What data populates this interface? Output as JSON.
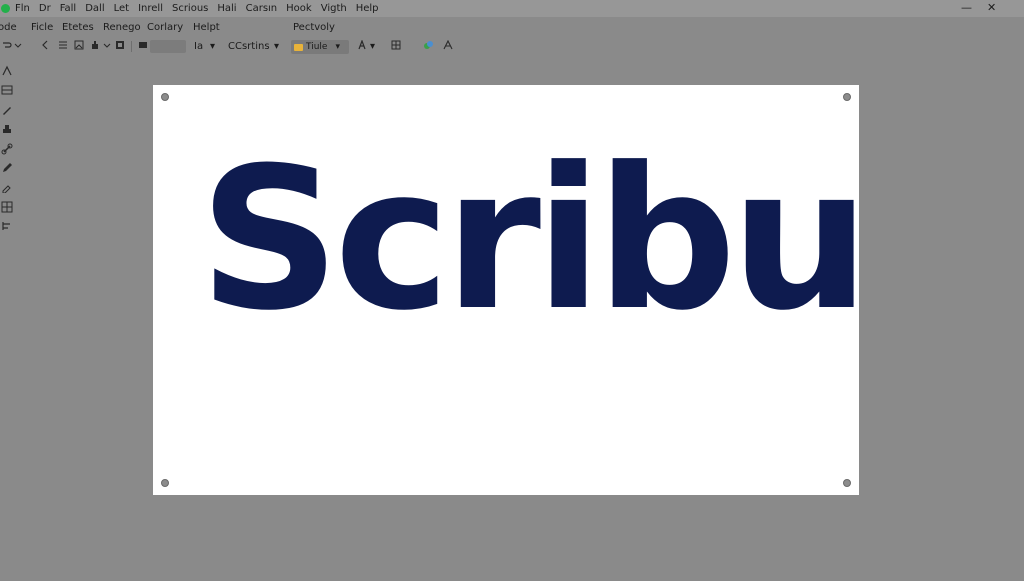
{
  "menubar": {
    "items": [
      "Fln",
      "Dr",
      "Fall",
      "Dall",
      "Let",
      "Inrell",
      "Scrious",
      "Hali",
      "Carsın",
      "Hook",
      "Vigth",
      "Help"
    ],
    "window_controls": {
      "minimize": "—",
      "close": "✕"
    }
  },
  "menubar2": {
    "items": [
      "ode",
      "Ficle",
      "Etetes",
      "Renego",
      "Corlary",
      "Helpt"
    ],
    "extra": "Pectvoly"
  },
  "toolbar": {
    "zoom_label": "Ia",
    "font_label": "Csrtins",
    "style_label": "Tiule",
    "caret": "▾"
  },
  "page": {
    "text": "Scribu"
  },
  "colors": {
    "workspace": "#8a8a8a",
    "page": "#ffffff",
    "text": "#0e1b4f",
    "app_icon": "#22b04a"
  },
  "icons": [
    "app-icon",
    "undo-icon",
    "list-icon",
    "image-icon",
    "clipboard-icon",
    "frame-icon",
    "text-size-icon",
    "dropdown-icon",
    "font-icon",
    "grid-icon",
    "color-icon",
    "select-tool-icon",
    "table-tool-icon",
    "pen-tool-icon",
    "stamp-tool-icon",
    "link-tool-icon",
    "pencil-tool-icon",
    "eyedropper-tool-icon",
    "grid-tool-icon",
    "align-tool-icon"
  ]
}
